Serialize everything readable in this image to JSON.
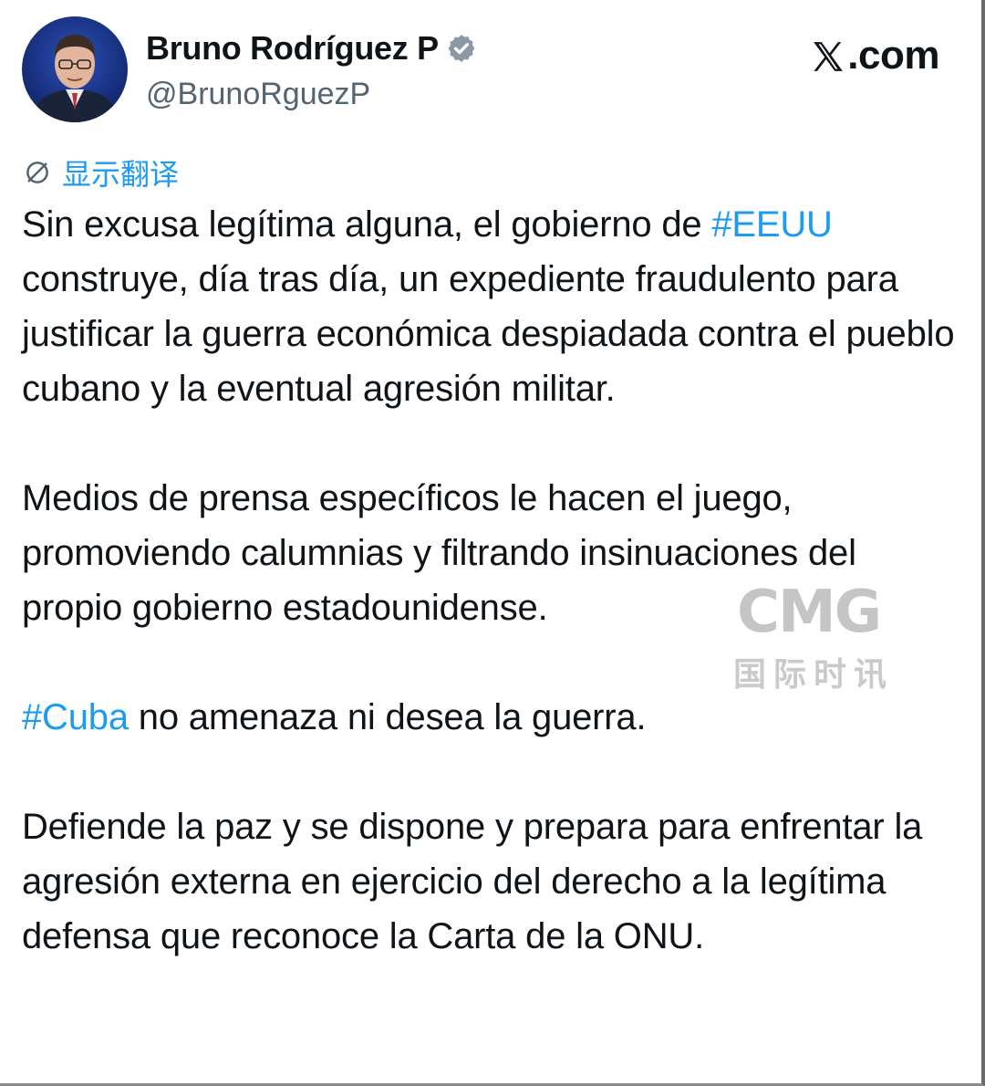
{
  "site": {
    "brand": ".com",
    "x_logo_icon": "x-logo-icon"
  },
  "author": {
    "display_name": "Bruno Rodríguez P",
    "handle": "@BrunoRguezP",
    "verified_icon": "verified-badge-icon",
    "avatar_icon": "avatar-portrait"
  },
  "translate": {
    "label": "显示翻译",
    "icon": "translate-globe-icon"
  },
  "tweet": {
    "p1_before": "Sin excusa legítima alguna, el gobierno de ",
    "p1_hashtag": "#EEUU",
    "p1_after": " construye, día tras día, un expediente fraudulento para justificar la guerra económica despiadada contra el pueblo cubano y la eventual agresión militar.",
    "p2": "Medios de prensa específicos le hacen el juego, promoviendo calumnias y filtrando insinuaciones del propio gobierno estadounidense.",
    "p3_hashtag": "#Cuba",
    "p3_after": " no amenaza ni desea la guerra.",
    "p4": "Defiende la paz y se dispone y prepara para enfrentar la agresión externa en ejercicio del derecho a  la legítima defensa que reconoce la Carta de la ONU."
  },
  "watermark": {
    "logo": "CMG",
    "subtitle": "国际时讯"
  },
  "colors": {
    "accent": "#1d9bf0",
    "text": "#0f1419",
    "muted": "#536471"
  }
}
